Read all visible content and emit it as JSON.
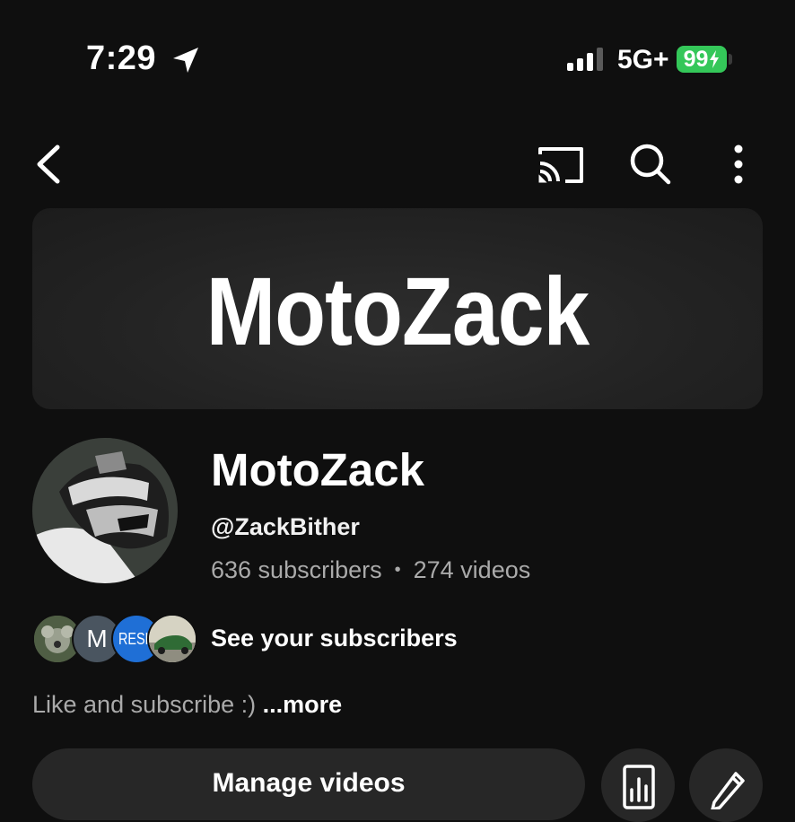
{
  "status_bar": {
    "time": "7:29",
    "network": "5G+",
    "battery": "99",
    "battery_color": "#34c759",
    "icons": [
      "location-arrow-icon",
      "signal-bars-icon",
      "battery-charging-icon"
    ]
  },
  "nav": {
    "icons": [
      "back-arrow-icon",
      "cast-icon",
      "search-icon",
      "more-vertical-icon"
    ]
  },
  "banner": {
    "text": "MotoZack"
  },
  "channel": {
    "name": "MotoZack",
    "handle": "@ZackBither",
    "subscribers": "636 subscribers",
    "separator": "•",
    "videos": "274 videos"
  },
  "subscribers_row": {
    "avatar_letter": "M",
    "avatar_text": "RESH",
    "label": "See your subscribers"
  },
  "description": {
    "text": "Like and subscribe :)",
    "more": "...more"
  },
  "actions": {
    "manage_label": "Manage videos",
    "icons": [
      "analytics-icon",
      "edit-pencil-icon"
    ]
  },
  "colors": {
    "background": "#0f0f0f",
    "button_bg": "#272727",
    "secondary_text": "#aaaaaa"
  }
}
